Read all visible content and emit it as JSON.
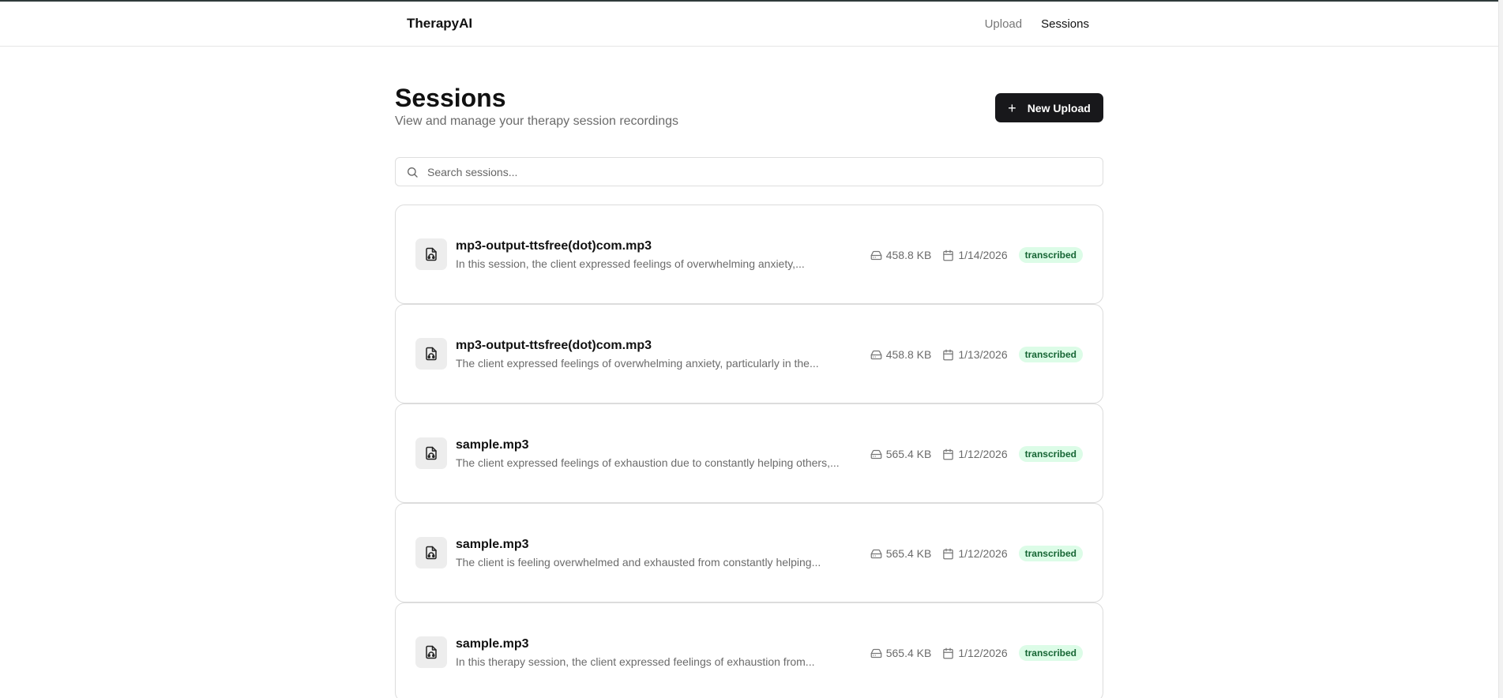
{
  "header": {
    "brand": "TherapyAI",
    "nav": [
      {
        "label": "Upload",
        "active": false
      },
      {
        "label": "Sessions",
        "active": true
      }
    ]
  },
  "page": {
    "title": "Sessions",
    "subtitle": "View and manage your therapy session recordings",
    "new_upload_label": "New Upload",
    "search_placeholder": "Search sessions..."
  },
  "sessions": [
    {
      "name": "mp3-output-ttsfree(dot)com.mp3",
      "summary": "In this session, the client expressed feelings of overwhelming anxiety,...",
      "size": "458.8 KB",
      "date": "1/14/2026",
      "status": "transcribed"
    },
    {
      "name": "mp3-output-ttsfree(dot)com.mp3",
      "summary": "The client expressed feelings of overwhelming anxiety, particularly in the...",
      "size": "458.8 KB",
      "date": "1/13/2026",
      "status": "transcribed"
    },
    {
      "name": "sample.mp3",
      "summary": "The client expressed feelings of exhaustion due to constantly helping others,...",
      "size": "565.4 KB",
      "date": "1/12/2026",
      "status": "transcribed"
    },
    {
      "name": "sample.mp3",
      "summary": "The client is feeling overwhelmed and exhausted from constantly helping...",
      "size": "565.4 KB",
      "date": "1/12/2026",
      "status": "transcribed"
    },
    {
      "name": "sample.mp3",
      "summary": "In this therapy session, the client expressed feelings of exhaustion from...",
      "size": "565.4 KB",
      "date": "1/12/2026",
      "status": "transcribed"
    }
  ],
  "colors": {
    "primary": "#18181b",
    "badge_bg": "#dcfce7",
    "badge_text": "#166534",
    "muted_text": "#6b6b6b"
  },
  "icons": {
    "search": "search-icon",
    "file": "file-audio-icon",
    "size": "hard-drive-icon",
    "date": "calendar-icon",
    "add": "plus-icon"
  }
}
